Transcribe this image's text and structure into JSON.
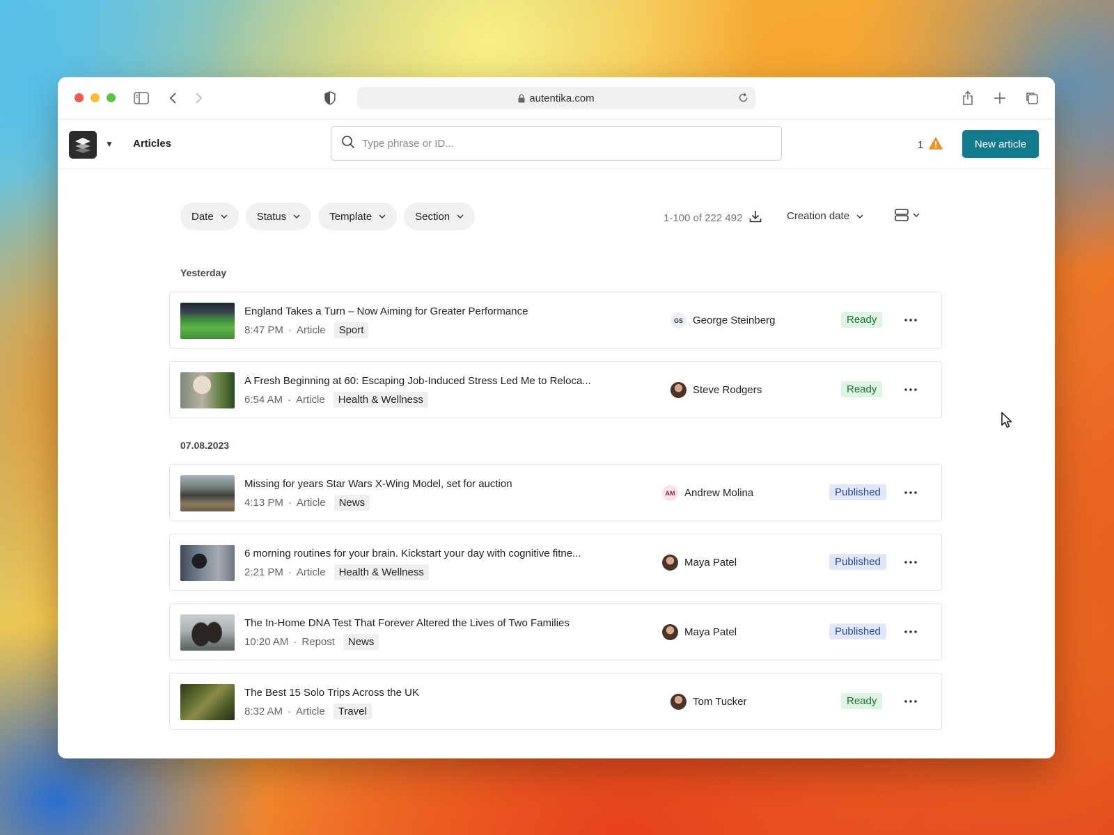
{
  "browser": {
    "url": "autentika.com"
  },
  "header": {
    "section_title": "Articles",
    "search_placeholder": "Type phrase or ID...",
    "alert_count": "1",
    "new_button": "New article"
  },
  "filters": [
    {
      "label": "Date"
    },
    {
      "label": "Status"
    },
    {
      "label": "Template"
    },
    {
      "label": "Section"
    }
  ],
  "results": {
    "count_text": "1-100 of 222 492",
    "sort_label": "Creation date"
  },
  "groups": [
    {
      "label": "Yesterday"
    },
    {
      "label": "07.08.2023"
    }
  ],
  "articles": [
    {
      "title": "England Takes a Turn – Now Aiming for Greater Performance",
      "time": "8:47 PM",
      "type": "Article",
      "tag": "Sport",
      "author": "George Steinberg",
      "initials": "GS",
      "status": "Ready"
    },
    {
      "title": "A Fresh Beginning at 60: Escaping Job-Induced Stress Led Me to Reloca...",
      "time": "6:54 AM",
      "type": "Article",
      "tag": "Health & Wellness",
      "author": "Steve Rodgers",
      "initials": "",
      "status": "Ready"
    },
    {
      "title": "Missing for years Star Wars X-Wing Model, set for auction",
      "time": "4:13 PM",
      "type": "Article",
      "tag": "News",
      "author": "Andrew Molina",
      "initials": "AM",
      "status": "Published"
    },
    {
      "title": "6 morning routines for your brain. Kickstart your day with cognitive fitne...",
      "time": "2:21 PM",
      "type": "Article",
      "tag": "Health & Wellness",
      "author": "Maya Patel",
      "initials": "",
      "status": "Published"
    },
    {
      "title": "The In-Home DNA Test That Forever Altered the Lives of Two Families",
      "time": "10:20 AM",
      "type": "Repost",
      "tag": "News",
      "author": "Maya Patel",
      "initials": "",
      "status": "Published"
    },
    {
      "title": "The Best 15 Solo Trips Across the UK",
      "time": "8:32 AM",
      "type": "Article",
      "tag": "Travel",
      "author": "Tom Tucker",
      "initials": "",
      "status": "Ready"
    }
  ],
  "meta_separator": "·",
  "colors": {
    "primary_button": "#137a8e",
    "ready_badge_bg": "#def5e3",
    "published_badge_bg": "#e0e8f8",
    "warning": "#e8902a"
  }
}
